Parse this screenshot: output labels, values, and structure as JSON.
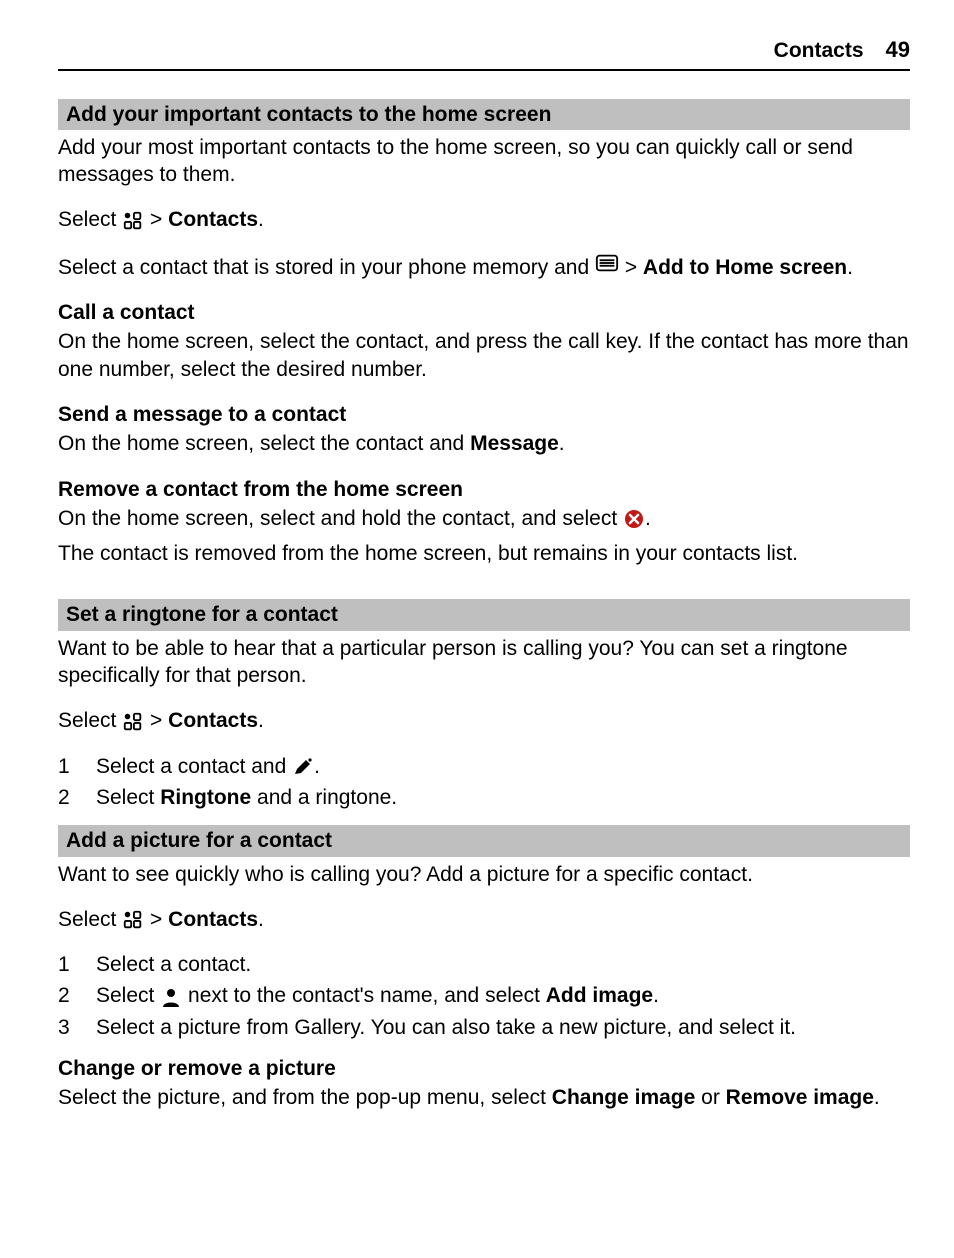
{
  "header": {
    "section": "Contacts",
    "page": "49"
  },
  "s1": {
    "title": "Add your important contacts to the home screen",
    "intro": "Add your most important contacts to the home screen, so you can quickly call or send messages to them.",
    "select_word": "Select ",
    "gt": " > ",
    "contacts": "Contacts",
    "period": ".",
    "line2a": "Select a contact that is stored in your phone memory and ",
    "line2b": "Add to Home screen",
    "call_head": "Call a contact",
    "call_body": "On the home screen, select the contact, and press the call key. If the contact has more than one number, select the desired number.",
    "msg_head": "Send a message to a contact",
    "msg_body_a": "On the home screen, select the contact and ",
    "msg_body_b": "Message",
    "rm_head": "Remove a contact from the home screen",
    "rm_body_a": "On the home screen, select and hold the contact, and select ",
    "rm_body_after": "The contact is removed from the home screen, but remains in your contacts list."
  },
  "s2": {
    "title": "Set a ringtone for a contact",
    "intro": "Want to be able to hear that a particular person is calling you? You can set a ringtone specifically for that person.",
    "select_word": "Select ",
    "gt": " > ",
    "contacts": "Contacts",
    "period": ".",
    "step1_a": "Select a contact and ",
    "step2_a": "Select ",
    "step2_b": "Ringtone",
    "step2_c": " and a ringtone.",
    "n1": "1",
    "n2": "2"
  },
  "s3": {
    "title": "Add a picture for a contact",
    "intro": "Want to see quickly who is calling you? Add a picture for a specific contact.",
    "select_word": "Select ",
    "gt": " > ",
    "contacts": "Contacts",
    "period": ".",
    "n1": "1",
    "n2": "2",
    "n3": "3",
    "step1": "Select a contact.",
    "step2_a": "Select ",
    "step2_b": " next to the contact's name, and select ",
    "step2_c": "Add image",
    "step3": "Select a picture from Gallery. You can also take a new picture, and select it.",
    "chg_head": "Change or remove a picture",
    "chg_a": "Select the picture, and from the pop-up menu, select ",
    "chg_b": "Change image",
    "chg_c": " or ",
    "chg_d": "Remove image",
    "chg_e": "."
  }
}
